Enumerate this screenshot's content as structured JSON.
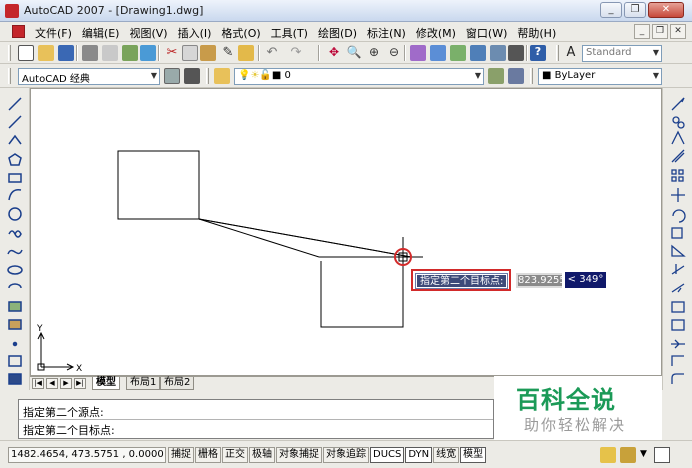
{
  "window": {
    "title": "AutoCAD 2007 - [Drawing1.dwg]",
    "minimize_icon": "minimize-icon",
    "restore_icon": "restore-icon",
    "close_icon": "close-icon"
  },
  "menubar": {
    "items": [
      "文件(F)",
      "编辑(E)",
      "视图(V)",
      "插入(I)",
      "格式(O)",
      "工具(T)",
      "绘图(D)",
      "标注(N)",
      "修改(M)",
      "窗口(W)",
      "帮助(H)"
    ],
    "mdi": [
      "_",
      "ᗙ",
      "✕"
    ]
  },
  "toolbar": {
    "text_style": "Standard"
  },
  "workspace": {
    "selected": "AutoCAD 经典",
    "layer_name": "0",
    "linetype": "ByLayer"
  },
  "canvas": {
    "ucs_x_label": "X",
    "ucs_y_label": "Y",
    "prompt_text": "指定第二个目标点:",
    "distance_value": "823.9255",
    "angle_value": "< 349°"
  },
  "tabs": {
    "items": [
      "模型",
      "布局1",
      "布局2"
    ],
    "active": "模型"
  },
  "command": {
    "line1": "指定第二个源点:",
    "line2": "指定第二个目标点:"
  },
  "watermark": {
    "title": "百科全说",
    "subtitle": "助你轻松解决"
  },
  "status": {
    "coordinates": "1482.4654, 473.5751 , 0.0000",
    "buttons": [
      "捕捉",
      "栅格",
      "正交",
      "极轴",
      "对象捕捉",
      "对象追踪",
      "DUCS",
      "DYN",
      "线宽",
      "模型"
    ]
  },
  "colors": {
    "accent_red": "#d22a2a",
    "tooltip_bg": "#3d4a79",
    "angle_bg": "#10196a",
    "watermark_green": "#1b9a57"
  }
}
